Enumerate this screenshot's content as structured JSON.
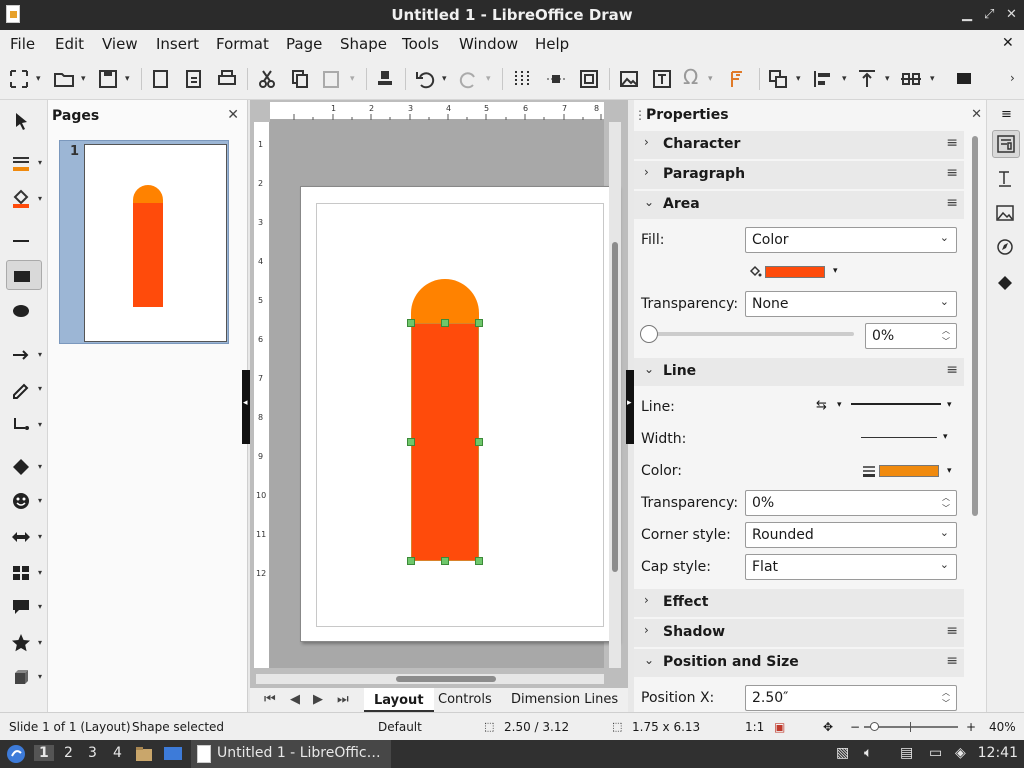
{
  "window": {
    "title": "Untitled 1 - LibreOffice Draw"
  },
  "menu": [
    "File",
    "Edit",
    "View",
    "Insert",
    "Format",
    "Page",
    "Shape",
    "Tools",
    "Window",
    "Help"
  ],
  "pages_panel": {
    "title": "Pages",
    "page_number": "1"
  },
  "ruler": {
    "h": [
      "1",
      "2",
      "3",
      "4",
      "5",
      "6",
      "7",
      "8"
    ],
    "v": [
      "1",
      "2",
      "3",
      "4",
      "5",
      "6",
      "7",
      "8",
      "9",
      "10",
      "11",
      "12"
    ]
  },
  "tabs": {
    "layout": "Layout",
    "controls": "Controls",
    "dimension_lines": "Dimension Lines"
  },
  "sidebar": {
    "title": "Properties",
    "sections": {
      "character": "Character",
      "paragraph": "Paragraph",
      "area": "Area",
      "line": "Line",
      "effect": "Effect",
      "shadow": "Shadow",
      "position_size": "Position and Size"
    },
    "area": {
      "fill_label": "Fill:",
      "fill_value": "Color",
      "fill_color": "#ff4b0b",
      "transparency_label": "Transparency:",
      "transparency_value": "None",
      "transparency_pct": "0%",
      "slider_level": 0
    },
    "line": {
      "line_label": "Line:",
      "width_label": "Width:",
      "color_label": "Color:",
      "color": "#f08a0e",
      "transparency_label": "Transparency:",
      "transparency_value": "0%",
      "corner_label": "Corner style:",
      "corner_value": "Rounded",
      "cap_label": "Cap style:",
      "cap_value": "Flat"
    },
    "position": {
      "x_label": "Position X:",
      "x_value": "2.50″"
    }
  },
  "status": {
    "slide": "Slide 1 of 1 (Layout)",
    "selection": "Shape selected",
    "style": "Default",
    "position": "2.50 / 3.12",
    "size": "1.75 x 6.13",
    "scale": "1:1",
    "zoom": "40%"
  },
  "taskbar": {
    "workspaces": [
      "1",
      "2",
      "3",
      "4"
    ],
    "task": "Untitled 1 - LibreOffic…",
    "clock": "12:41"
  },
  "colors": {
    "shape_main": "#ff4b0b",
    "shape_top": "#ff8200",
    "handle": "#6fc76b"
  }
}
